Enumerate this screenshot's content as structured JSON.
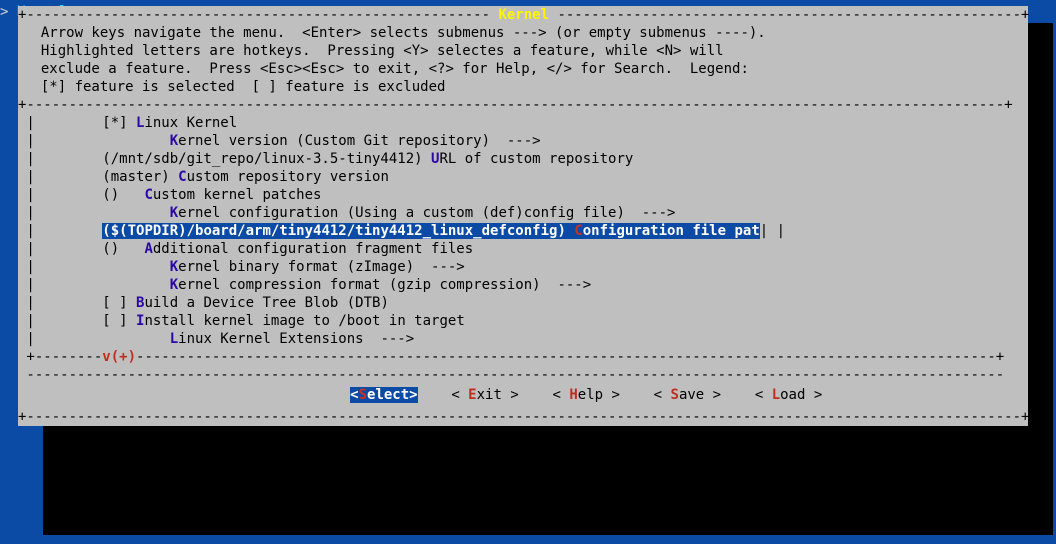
{
  "window": {
    "title": "Kernel"
  },
  "header": {
    "title": "Kernel",
    "help_lines": [
      "Arrow keys navigate the menu.  <Enter> selects submenus ---> (or empty submenus ----).",
      "Highlighted letters are hotkeys.  Pressing <Y> selectes a feature, while <N> will",
      "exclude a feature.  Press <Esc><Esc> to exit, <?> for Help, </> for Search.  Legend:",
      "[*] feature is selected  [ ] feature is excluded"
    ]
  },
  "menu": {
    "items": [
      {
        "indent": 0,
        "prefix": "[*] ",
        "hot": "L",
        "text": "inux Kernel",
        "selected": false
      },
      {
        "indent": 1,
        "prefix": "    ",
        "hot": "K",
        "text": "ernel version (Custom Git repository)  --->",
        "selected": false
      },
      {
        "indent": 0,
        "prefix": "(/mnt/sdb/git_repo/linux-3.5-tiny4412) ",
        "hot": "U",
        "text": "RL of custom repository",
        "selected": false
      },
      {
        "indent": 0,
        "prefix": "(master) ",
        "hot": "C",
        "text": "ustom repository version",
        "selected": false
      },
      {
        "indent": 0,
        "prefix": "()   ",
        "hot": "C",
        "text": "ustom kernel patches",
        "selected": false
      },
      {
        "indent": 1,
        "prefix": "    ",
        "hot": "K",
        "text": "ernel configuration (Using a custom (def)config file)  --->",
        "selected": false
      },
      {
        "indent": 0,
        "prefix": "($(TOPDIR)/board/arm/tiny4412/tiny4412_linux_defconfig) ",
        "hot": "C",
        "text": "onfiguration file pat",
        "selected": true
      },
      {
        "indent": 0,
        "prefix": "()   ",
        "hot": "A",
        "text": "dditional configuration fragment files",
        "selected": false
      },
      {
        "indent": 1,
        "prefix": "    ",
        "hot": "K",
        "text": "ernel binary format (zImage)  --->",
        "selected": false
      },
      {
        "indent": 1,
        "prefix": "    ",
        "hot": "K",
        "text": "ernel compression format (gzip compression)  --->",
        "selected": false
      },
      {
        "indent": 0,
        "prefix": "[ ] ",
        "hot": "B",
        "text": "uild a Device Tree Blob (DTB)",
        "selected": false
      },
      {
        "indent": 0,
        "prefix": "[ ] ",
        "hot": "I",
        "text": "nstall kernel image to /boot in target",
        "selected": false
      },
      {
        "indent": 1,
        "prefix": "    ",
        "hot": "L",
        "text": "inux Kernel Extensions  --->",
        "selected": false
      }
    ],
    "more": "v(+)"
  },
  "buttons": [
    {
      "left": "<",
      "hot": "S",
      "rest": "elect",
      "right": ">",
      "selected": true
    },
    {
      "left": "< ",
      "hot": "E",
      "rest": "xit ",
      "right": ">",
      "selected": false
    },
    {
      "left": "< ",
      "hot": "H",
      "rest": "elp ",
      "right": ">",
      "selected": false
    },
    {
      "left": "< ",
      "hot": "S",
      "rest": "ave ",
      "right": ">",
      "selected": false
    },
    {
      "left": "< ",
      "hot": "L",
      "rest": "oad ",
      "right": ">",
      "selected": false
    }
  ]
}
